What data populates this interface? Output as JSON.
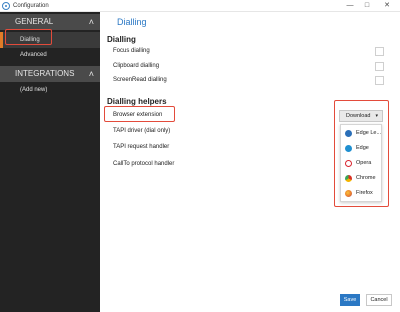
{
  "window": {
    "title": "Configuration",
    "minimize_glyph": "—",
    "maximize_glyph": "□",
    "close_glyph": "✕"
  },
  "sidebar": {
    "sections": [
      {
        "label": "GENERAL",
        "chevron": "˄",
        "items": [
          {
            "label": "Dialling",
            "active": true
          },
          {
            "label": "Advanced",
            "active": false
          }
        ]
      },
      {
        "label": "INTEGRATIONS",
        "chevron": "˄",
        "items": [
          {
            "label": "(Add new)",
            "active": false
          }
        ]
      }
    ]
  },
  "main": {
    "page_title": "Dialling",
    "dialling": {
      "section_title": "Dialling",
      "rows": [
        {
          "label": "Focus dialling",
          "checked": false
        },
        {
          "label": "Clipboard dialling",
          "checked": false
        },
        {
          "label": "ScreenRead dialling",
          "checked": false
        }
      ]
    },
    "helpers": {
      "section_title": "Dialling helpers",
      "rows": [
        {
          "label": "Browser extension"
        },
        {
          "label": "TAPI driver (dial only)"
        },
        {
          "label": "TAPI request handler"
        },
        {
          "label": "CallTo protocol handler"
        }
      ]
    },
    "download": {
      "button_label": "Download",
      "arrow": "▾",
      "options": [
        {
          "label": "Edge Le...",
          "icon": "edge-legacy-icon",
          "color": "#2b6fb8"
        },
        {
          "label": "Edge",
          "icon": "edge-icon",
          "color": "#1f8fd0"
        },
        {
          "label": "Opera",
          "icon": "opera-icon",
          "color": "#d9252f"
        },
        {
          "label": "Chrome",
          "icon": "chrome-icon",
          "color": "#3aa757"
        },
        {
          "label": "Firefox",
          "icon": "firefox-icon",
          "color": "#e8772e"
        }
      ]
    }
  },
  "footer": {
    "save_label": "Save",
    "cancel_label": "Cancel"
  },
  "colors": {
    "accent": "#2b78c4",
    "sidebar_bg": "#232323",
    "active_marker": "#e07b27",
    "annotation": "#e34b3b"
  }
}
